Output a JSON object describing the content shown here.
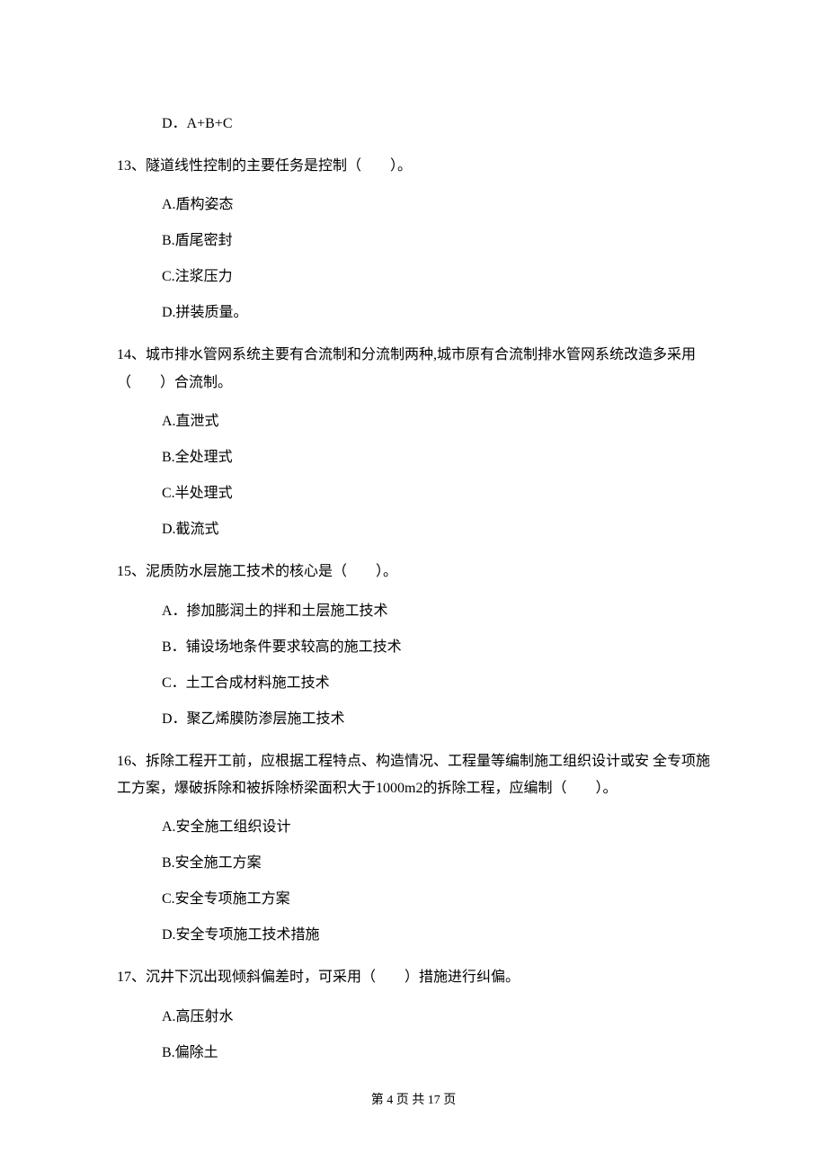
{
  "prev_option_d": "D．A+B+C",
  "q13": {
    "stem": "13、隧道线性控制的主要任务是控制（　　）。",
    "A": "A.盾构姿态",
    "B": "B.盾尾密封",
    "C": "C.注浆压力",
    "D": "D.拼装质量。"
  },
  "q14": {
    "stem": "14、城市排水管网系统主要有合流制和分流制两种,城市原有合流制排水管网系统改造多采用（　　）合流制。",
    "A": "A.直泄式",
    "B": "B.全处理式",
    "C": "C.半处理式",
    "D": "D.截流式"
  },
  "q15": {
    "stem": "15、泥质防水层施工技术的核心是（　　）。",
    "A": "A．掺加膨润土的拌和土层施工技术",
    "B": "B．铺设场地条件要求较高的施工技术",
    "C": "C．土工合成材料施工技术",
    "D": "D．聚乙烯膜防渗层施工技术"
  },
  "q16": {
    "stem": "16、拆除工程开工前，应根据工程特点、构造情况、工程量等编制施工组织设计或安 全专项施工方案，爆破拆除和被拆除桥梁面积大于1000m2的拆除工程，应编制（　　）。",
    "A": "A.安全施工组织设计",
    "B": "B.安全施工方案",
    "C": "C.安全专项施工方案",
    "D": "D.安全专项施工技术措施"
  },
  "q17": {
    "stem": "17、沉井下沉出现倾斜偏差时，可采用（　　）措施进行纠偏。",
    "A": "A.高压射水",
    "B": "B.偏除土"
  },
  "footer": "第 4 页 共 17 页"
}
